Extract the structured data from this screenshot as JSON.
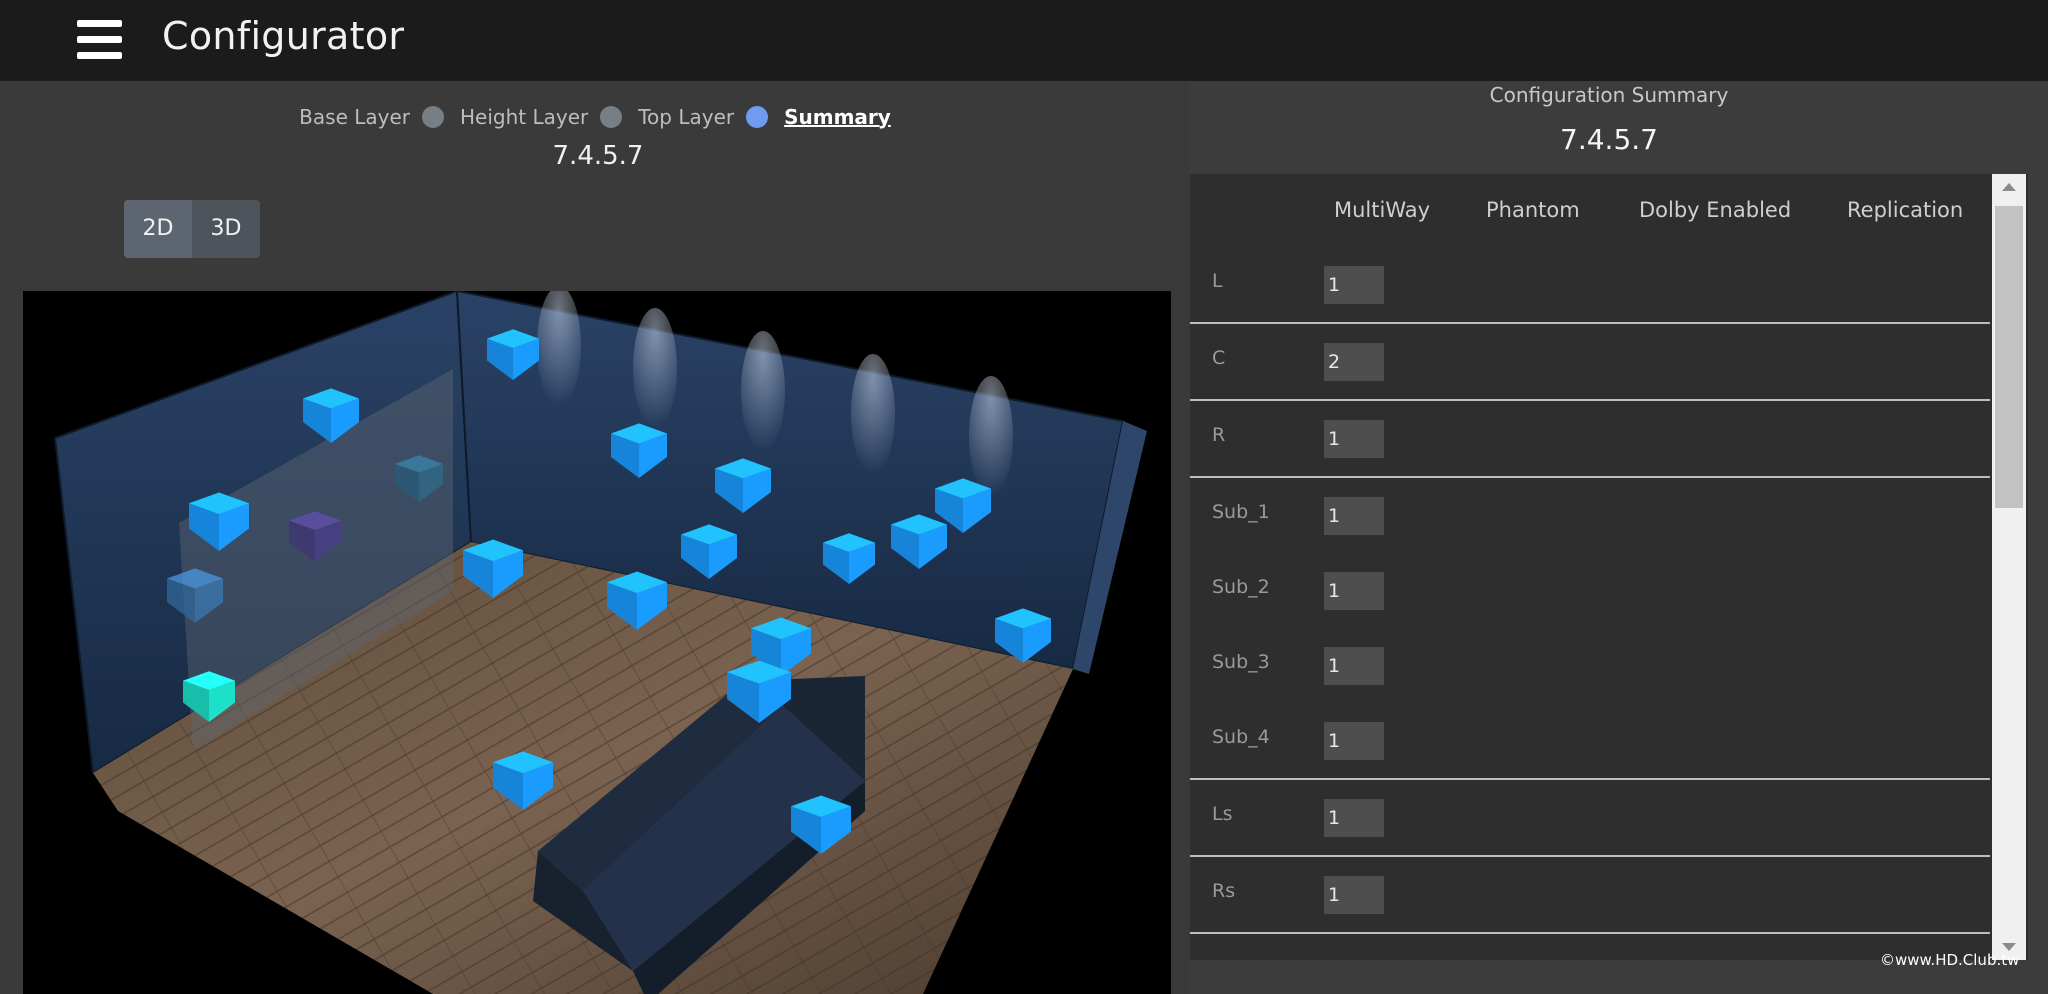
{
  "header": {
    "title": "Configurator",
    "menu_icon": "hamburger-menu-icon"
  },
  "stepper": {
    "steps": [
      {
        "label": "Base Layer",
        "state": "done"
      },
      {
        "label": "Height Layer",
        "state": "done"
      },
      {
        "label": "Top Layer",
        "state": "active"
      },
      {
        "label": "Summary",
        "state": "current"
      }
    ],
    "version": "7.4.5.7"
  },
  "view_toggle": {
    "option_2d": "2D",
    "option_3d": "3D",
    "selected": "2D"
  },
  "summary": {
    "title": "Configuration Summary",
    "version": "7.4.5.7",
    "columns": [
      "MultiWay",
      "Phantom",
      "Dolby Enabled",
      "Replication"
    ],
    "rows": [
      {
        "label": "L",
        "value": "1"
      },
      {
        "label": "C",
        "value": "2"
      },
      {
        "label": "R",
        "value": "1"
      },
      {
        "label": "Sub_1",
        "value": "1"
      },
      {
        "label": "Sub_2",
        "value": "1"
      },
      {
        "label": "Sub_3",
        "value": "1"
      },
      {
        "label": "Sub_4",
        "value": "1"
      },
      {
        "label": "Ls",
        "value": "1"
      },
      {
        "label": "Rs",
        "value": "1"
      }
    ]
  },
  "watermark": "©www.HD.Club.tw",
  "colors": {
    "topbar": "#1b1b1b",
    "speaker": "#1a9cff",
    "speaker_selected": "#1de0c8",
    "wall": "#1e3350",
    "floor": "#6a5440",
    "step_active": "#6f9bf0"
  }
}
